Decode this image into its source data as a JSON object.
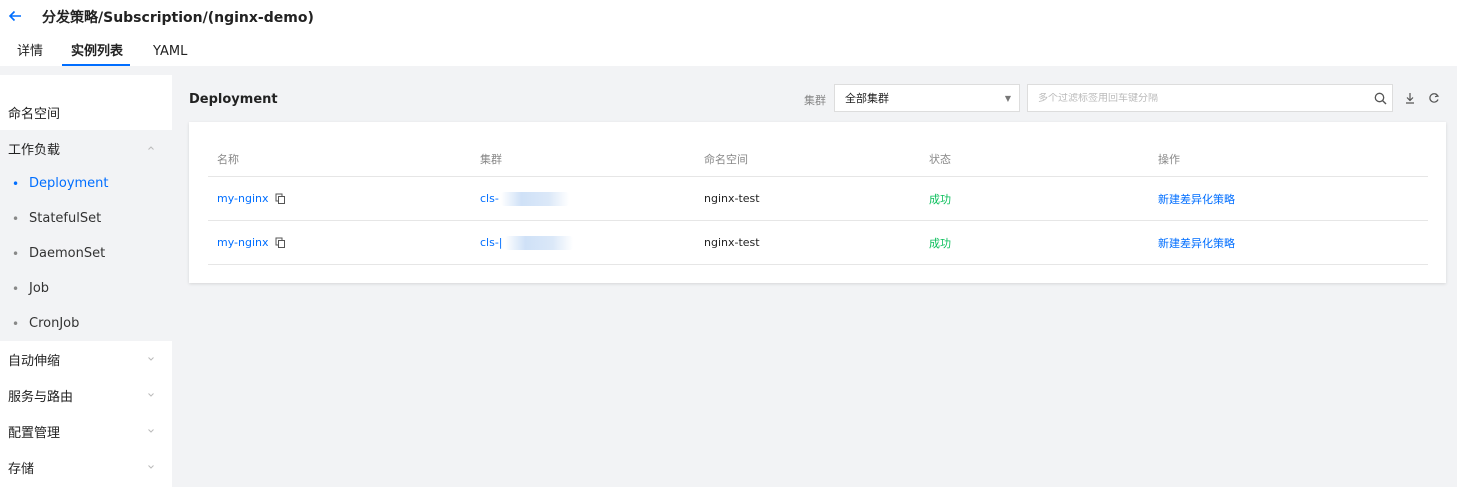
{
  "header": {
    "title": "分发策略/Subscription/(nginx-demo)",
    "tabs": [
      {
        "label": "详情",
        "active": false
      },
      {
        "label": "实例列表",
        "active": true
      },
      {
        "label": "YAML",
        "active": false
      }
    ]
  },
  "sidebar": {
    "groups": [
      {
        "label": "命名空间"
      },
      {
        "label": "工作负载",
        "expanded": true,
        "items": [
          "Deployment",
          "StatefulSet",
          "DaemonSet",
          "Job",
          "CronJob"
        ],
        "active_item": "Deployment"
      },
      {
        "label": "自动伸缩"
      },
      {
        "label": "服务与路由"
      },
      {
        "label": "配置管理"
      },
      {
        "label": "存储"
      }
    ]
  },
  "main": {
    "title": "Deployment",
    "cluster_label": "集群",
    "cluster_select_value": "全部集群",
    "search_placeholder": "多个过滤标签用回车键分隔"
  },
  "table": {
    "columns": [
      "名称",
      "集群",
      "命名空间",
      "状态",
      "操作"
    ],
    "rows": [
      {
        "name": "my-nginx",
        "cluster": "cls-",
        "namespace": "nginx-test",
        "status": "成功",
        "action": "新建差异化策略"
      },
      {
        "name": "my-nginx",
        "cluster": "cls-|",
        "namespace": "nginx-test",
        "status": "成功",
        "action": "新建差异化策略"
      }
    ]
  },
  "colors": {
    "accent": "#006eff",
    "success": "#0abf5b"
  },
  "icons": [
    "back-arrow-icon",
    "chevron-up-icon",
    "chevron-down-icon",
    "caret-down-icon",
    "search-icon",
    "download-icon",
    "refresh-icon",
    "copy-icon"
  ]
}
